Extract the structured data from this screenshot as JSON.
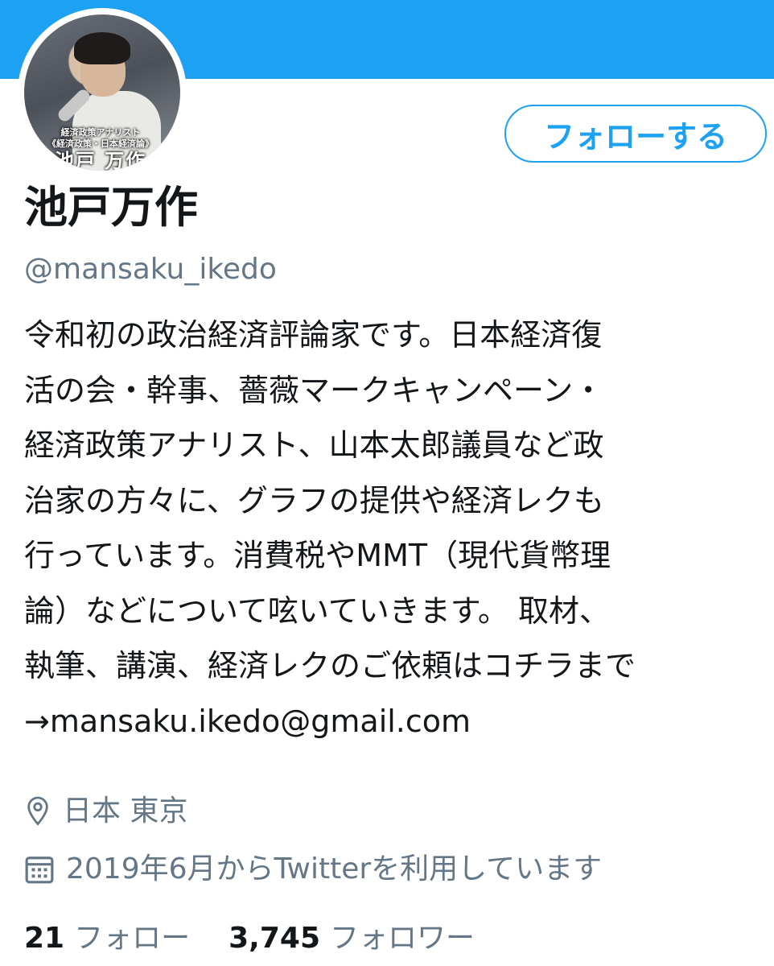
{
  "profile": {
    "display_name": "池戸万作",
    "handle": "@mansaku_ikedo",
    "follow_button_label": "フォローする",
    "avatar": {
      "caption_small_1": "経済政策アナリスト",
      "caption_small_2": "《経済政策・日本経済論》",
      "caption_name": "池戸 万作"
    },
    "bio_lines": [
      "令和初の政治経済評論家です。日本経済復",
      "活の会・幹事、薔薇マークキャンペーン・",
      "経済政策アナリスト、山本太郎議員など政",
      "治家の方々に、グラフの提供や経済レクも",
      "行っています。消費税やMMT（現代貨幣理",
      "論）などについて呟いていきます。 取材、",
      "執筆、講演、経済レクのご依頼はコチラまで",
      "→mansaku.ikedo@gmail.com"
    ],
    "location": "日本 東京",
    "joined": "2019年6月からTwitterを利用しています",
    "following_count": "21",
    "following_label": "フォロー",
    "followers_count": "3,745",
    "followers_label": "フォロワー"
  },
  "colors": {
    "accent": "#1da1f2",
    "secondary_text": "#657786",
    "primary_text": "#14171a"
  },
  "icons": {
    "location": "location-pin-icon",
    "joined": "calendar-icon"
  }
}
